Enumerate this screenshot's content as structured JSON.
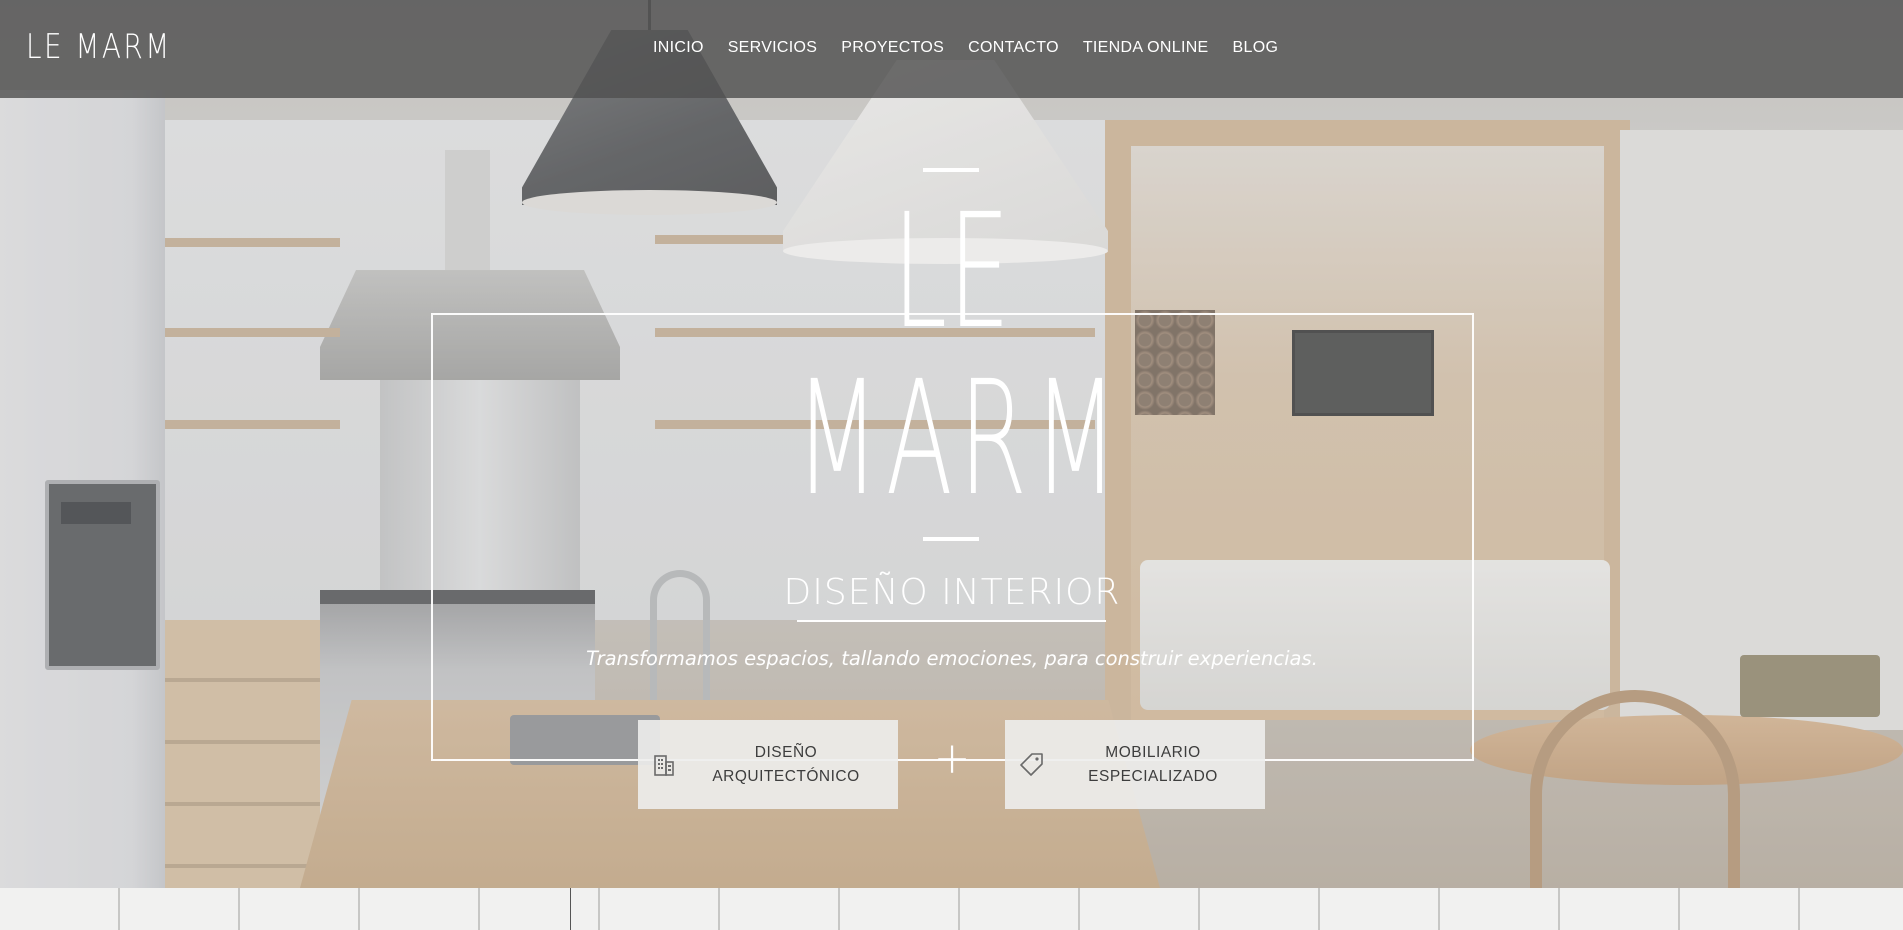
{
  "brand": {
    "logo_text": "LE MARM"
  },
  "nav": {
    "items": [
      {
        "label": "INICIO"
      },
      {
        "label": "SERVICIOS"
      },
      {
        "label": "PROYECTOS"
      },
      {
        "label": "CONTACTO"
      },
      {
        "label": "TIENDA ONLINE"
      },
      {
        "label": "BLOG"
      }
    ]
  },
  "hero": {
    "logo_line1": "LE",
    "logo_line2": "MARM",
    "subtitle": "DISEÑO INTERIOR",
    "tagline": "Transformamos espacios, tallando emociones, para construir experiencias.",
    "plus_sign": "+"
  },
  "services": [
    {
      "line1": "DISEÑO",
      "line2": "ARQUITECTÓNICO",
      "icon": "building-icon"
    },
    {
      "line1": "MOBILIARIO",
      "line2": "ESPECIALIZADO",
      "icon": "tag-icon"
    }
  ],
  "colors": {
    "header_bg": "#505050",
    "text_light": "#ffffff",
    "button_bg": "#edecec",
    "button_text": "#3d3d3d"
  }
}
